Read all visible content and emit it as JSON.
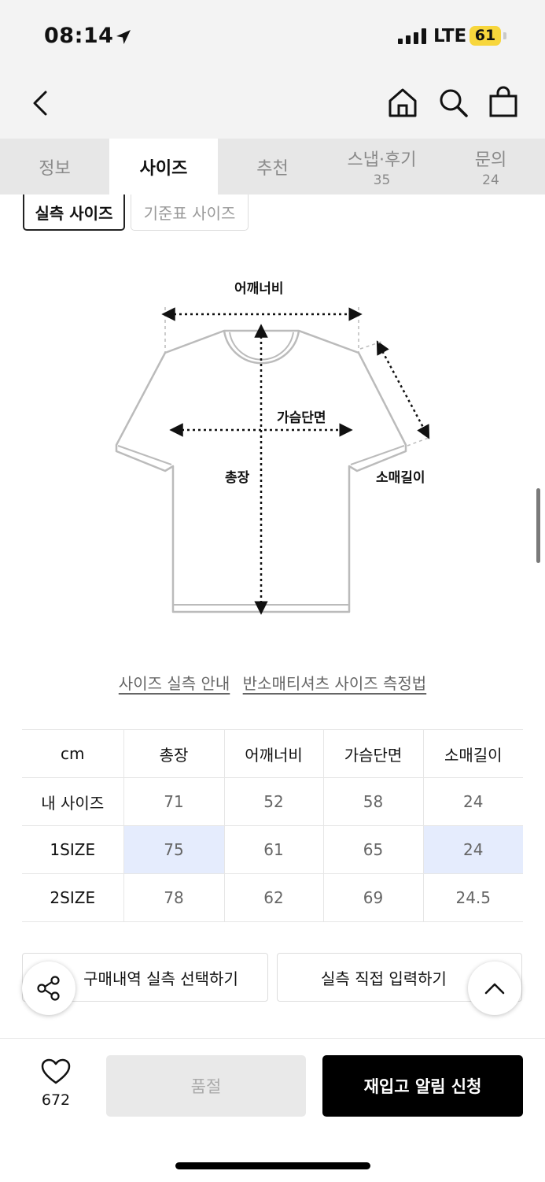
{
  "status": {
    "time": "08:14",
    "network": "LTE",
    "battery": "61"
  },
  "tabs": [
    {
      "label": "정보",
      "count": ""
    },
    {
      "label": "사이즈",
      "count": ""
    },
    {
      "label": "추천",
      "count": ""
    },
    {
      "label": "스냅·후기",
      "count": "35"
    },
    {
      "label": "문의",
      "count": "24"
    }
  ],
  "segments": {
    "actual": "실측 사이즈",
    "standard": "기준표 사이즈"
  },
  "diagram": {
    "shoulder": "어깨너비",
    "chest": "가슴단면",
    "length": "총장",
    "sleeve": "소매길이"
  },
  "links": {
    "guide": "사이즈 실측 안내",
    "method": "반소매티셔츠 사이즈 측정법"
  },
  "table": {
    "unit": "cm",
    "columns": [
      "총장",
      "어깨너비",
      "가슴단면",
      "소매길이"
    ],
    "rows": [
      {
        "name": "내 사이즈",
        "values": [
          "71",
          "52",
          "58",
          "24"
        ]
      },
      {
        "name": "1SIZE",
        "values": [
          "75",
          "61",
          "65",
          "24"
        ]
      },
      {
        "name": "2SIZE",
        "values": [
          "78",
          "62",
          "69",
          "24.5"
        ]
      }
    ]
  },
  "actions": {
    "purchase_select": "구매내역 실측 선택하기",
    "direct_input": "실측 직접 입력하기"
  },
  "bottom": {
    "likes": "672",
    "soldout": "품절",
    "restock": "재입고 알림 신청"
  }
}
